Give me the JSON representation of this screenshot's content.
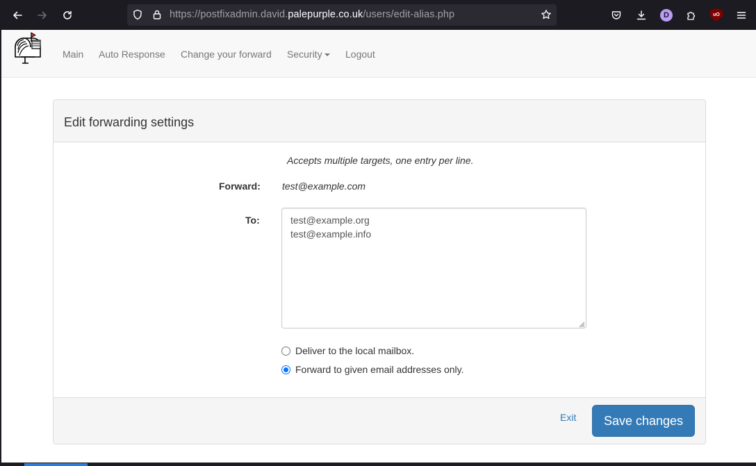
{
  "browser": {
    "url_prefix": "https://postfixadmin.david.",
    "url_domain": "palepurple.co.uk",
    "url_path": "/users/edit-alias.php",
    "profile_initial": "D",
    "ublock_badge": "uO",
    "icons": {
      "back": "arrow-left-icon",
      "forward": "arrow-right-icon",
      "reload": "reload-icon",
      "tracking": "shield-icon",
      "secure": "lock-icon",
      "bookmark": "star-icon",
      "pocket": "pocket-icon",
      "downloads": "download-icon",
      "extensions": "puzzle-icon",
      "menu": "hamburger-menu-icon"
    }
  },
  "nav": {
    "logo": "mailbox-logo",
    "items": [
      {
        "label": "Main"
      },
      {
        "label": "Auto Response"
      },
      {
        "label": "Change your forward"
      },
      {
        "label": "Security"
      },
      {
        "label": "Logout"
      }
    ]
  },
  "panel": {
    "title": "Edit forwarding settings",
    "hint": "Accepts multiple targets, one entry per line.",
    "forward_label": "Forward:",
    "forward_value": "test@example.com",
    "to_label": "To:",
    "to_value": "test@example.org\ntest@example.info",
    "radios": [
      {
        "label": "Deliver to the local mailbox.",
        "checked": false
      },
      {
        "label": "Forward to given email addresses only.",
        "checked": true
      }
    ],
    "exit_label": "Exit",
    "save_label": "Save changes"
  },
  "colors": {
    "browser_toolbar": "#1c1b22",
    "urlbar": "#2b2a33",
    "link": "#337ab7",
    "primary_button": "#337ab7",
    "radio_checked": "#0075ff"
  }
}
